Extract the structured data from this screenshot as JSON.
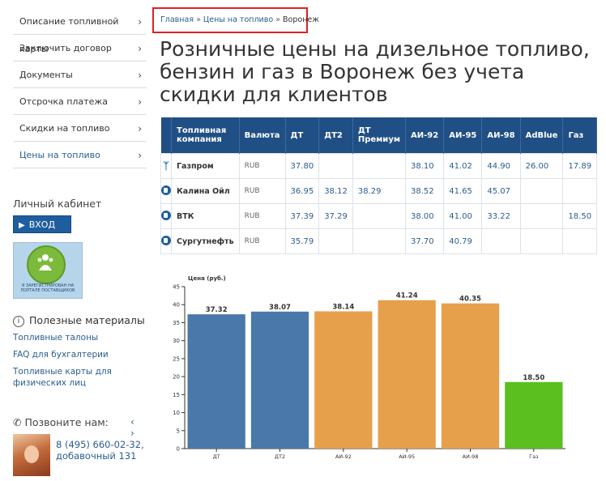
{
  "sidebar": {
    "menu": [
      {
        "label": "Описание топливной карты",
        "chev": "›"
      },
      {
        "label": "Заключить договор",
        "chev": "›"
      },
      {
        "label": "Документы",
        "chev": "›"
      },
      {
        "label": "Отсрочка платежа",
        "chev": "›"
      },
      {
        "label": "Скидки на топливо",
        "chev": "›"
      },
      {
        "label": "Цены на топливо",
        "chev": "›"
      }
    ],
    "cabinet_title": "Личный кабинет",
    "login_label": "ВХОД",
    "badge_text": "Я ЗАРЕГИСТРИРОВАН НА ПОРТАЛЕ ПОСТАВЩИКОВ",
    "useful_title": "Полезные материалы",
    "useful_links": [
      "Топливные талоны",
      "FAQ для бухгалтерии",
      "Топливные карты для физических лиц"
    ],
    "call_title": "Позвоните нам:",
    "nav_arrows": "‹ ›",
    "phone": "8 (495) 660-02-32,",
    "extension": "добавочный 131"
  },
  "breadcrumb": {
    "home": "Главная",
    "prices": "Цены на топливо",
    "current": "Воронеж",
    "separator": "»"
  },
  "page_title": "Розничные цены на дизельное топливо, бензин и газ в Воронеж без учета скидки для клиентов",
  "table": {
    "headers": [
      "",
      "Топливная компания",
      "Валюта",
      "ДТ",
      "ДТ2",
      "ДТ Премиум",
      "АИ-92",
      "АИ-95",
      "АИ-98",
      "AdBlue",
      "Газ"
    ],
    "rows": [
      {
        "icon": "gazprom-logo-icon",
        "cells": [
          "Газпром",
          "RUB",
          "37.80",
          "",
          "",
          "38.10",
          "41.02",
          "44.90",
          "26.00",
          "17.89"
        ]
      },
      {
        "icon": "fuel-pump-icon",
        "cells": [
          "Калина Ойл",
          "RUB",
          "36.95",
          "38.12",
          "38.29",
          "38.52",
          "41.65",
          "45.07",
          "",
          ""
        ]
      },
      {
        "icon": "fuel-pump-icon",
        "cells": [
          "ВТК",
          "RUB",
          "37.39",
          "37.29",
          "",
          "38.00",
          "41.00",
          "33.22",
          "",
          "18.50"
        ]
      },
      {
        "icon": "fuel-pump-icon",
        "cells": [
          "Сургутнефть",
          "RUB",
          "35.79",
          "",
          "",
          "37.70",
          "40.79",
          "",
          "",
          ""
        ]
      }
    ]
  },
  "chart_data": {
    "type": "bar",
    "title": "",
    "ylabel": "Цена (руб.)",
    "xlabel": "",
    "categories": [
      "ДТ",
      "ДТ2",
      "АИ-92",
      "АИ-95",
      "АИ-98",
      "Газ"
    ],
    "values": [
      37.32,
      38.07,
      38.14,
      41.24,
      40.35,
      18.5
    ],
    "value_labels": [
      "37.32",
      "38.07",
      "38.14",
      "41.24",
      "40.35",
      "18.50"
    ],
    "bar_colors": [
      "#4a78aa",
      "#4a78aa",
      "#e6a04b",
      "#e6a04b",
      "#e6a04b",
      "#5bbf1f"
    ],
    "ylim": [
      0,
      45
    ],
    "yticks": [
      "0",
      "5",
      "10",
      "15",
      "20",
      "25",
      "30",
      "35",
      "40",
      "45"
    ],
    "grid": false,
    "legend": "none"
  }
}
